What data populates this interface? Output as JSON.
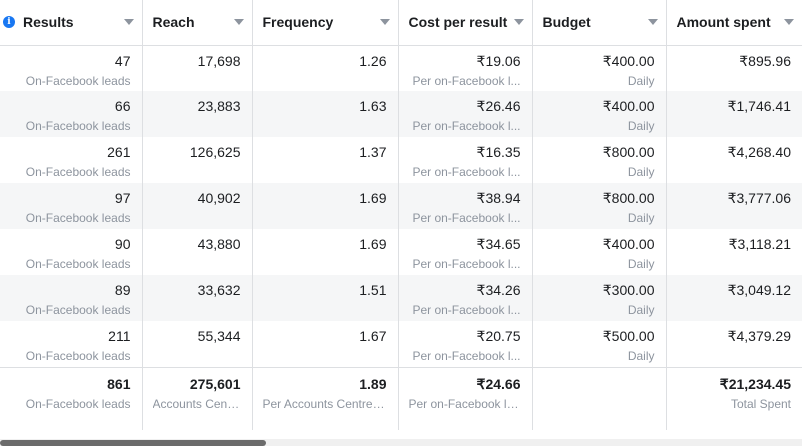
{
  "columns": [
    {
      "label": "Results",
      "has_info": true
    },
    {
      "label": "Reach"
    },
    {
      "label": "Frequency"
    },
    {
      "label": "Cost per result"
    },
    {
      "label": "Budget"
    },
    {
      "label": "Amount spent"
    }
  ],
  "rows": [
    {
      "results": "47",
      "results_sub": "On-Facebook leads",
      "reach": "17,698",
      "frequency": "1.26",
      "cost": "₹19.06",
      "cost_sub": "Per on-Facebook l...",
      "budget": "₹400.00",
      "budget_sub": "Daily",
      "spent": "₹895.96"
    },
    {
      "results": "66",
      "results_sub": "On-Facebook leads",
      "reach": "23,883",
      "frequency": "1.63",
      "cost": "₹26.46",
      "cost_sub": "Per on-Facebook l...",
      "budget": "₹400.00",
      "budget_sub": "Daily",
      "spent": "₹1,746.41"
    },
    {
      "results": "261",
      "results_sub": "On-Facebook leads",
      "reach": "126,625",
      "frequency": "1.37",
      "cost": "₹16.35",
      "cost_sub": "Per on-Facebook l...",
      "budget": "₹800.00",
      "budget_sub": "Daily",
      "spent": "₹4,268.40"
    },
    {
      "results": "97",
      "results_sub": "On-Facebook leads",
      "reach": "40,902",
      "frequency": "1.69",
      "cost": "₹38.94",
      "cost_sub": "Per on-Facebook l...",
      "budget": "₹800.00",
      "budget_sub": "Daily",
      "spent": "₹3,777.06"
    },
    {
      "results": "90",
      "results_sub": "On-Facebook leads",
      "reach": "43,880",
      "frequency": "1.69",
      "cost": "₹34.65",
      "cost_sub": "Per on-Facebook l...",
      "budget": "₹400.00",
      "budget_sub": "Daily",
      "spent": "₹3,118.21"
    },
    {
      "results": "89",
      "results_sub": "On-Facebook leads",
      "reach": "33,632",
      "frequency": "1.51",
      "cost": "₹34.26",
      "cost_sub": "Per on-Facebook l...",
      "budget": "₹300.00",
      "budget_sub": "Daily",
      "spent": "₹3,049.12"
    },
    {
      "results": "211",
      "results_sub": "On-Facebook leads",
      "reach": "55,344",
      "frequency": "1.67",
      "cost": "₹20.75",
      "cost_sub": "Per on-Facebook l...",
      "budget": "₹500.00",
      "budget_sub": "Daily",
      "spent": "₹4,379.29"
    }
  ],
  "totals": {
    "results": "861",
    "results_sub": "On-Facebook leads",
    "reach": "275,601",
    "reach_sub": "Accounts Centr...",
    "frequency": "1.89",
    "frequency_sub": "Per Accounts Centre a...",
    "cost": "₹24.66",
    "cost_sub": "Per on-Facebook lea...",
    "spent": "₹21,234.45",
    "spent_sub": "Total Spent"
  },
  "icons": {
    "info": "info-icon",
    "sort": "sort-caret-down-icon"
  },
  "colors": {
    "accent": "#1877f2",
    "muted_text": "#8d949e",
    "row_alt": "#f5f6f7",
    "border": "#dddfe2"
  }
}
